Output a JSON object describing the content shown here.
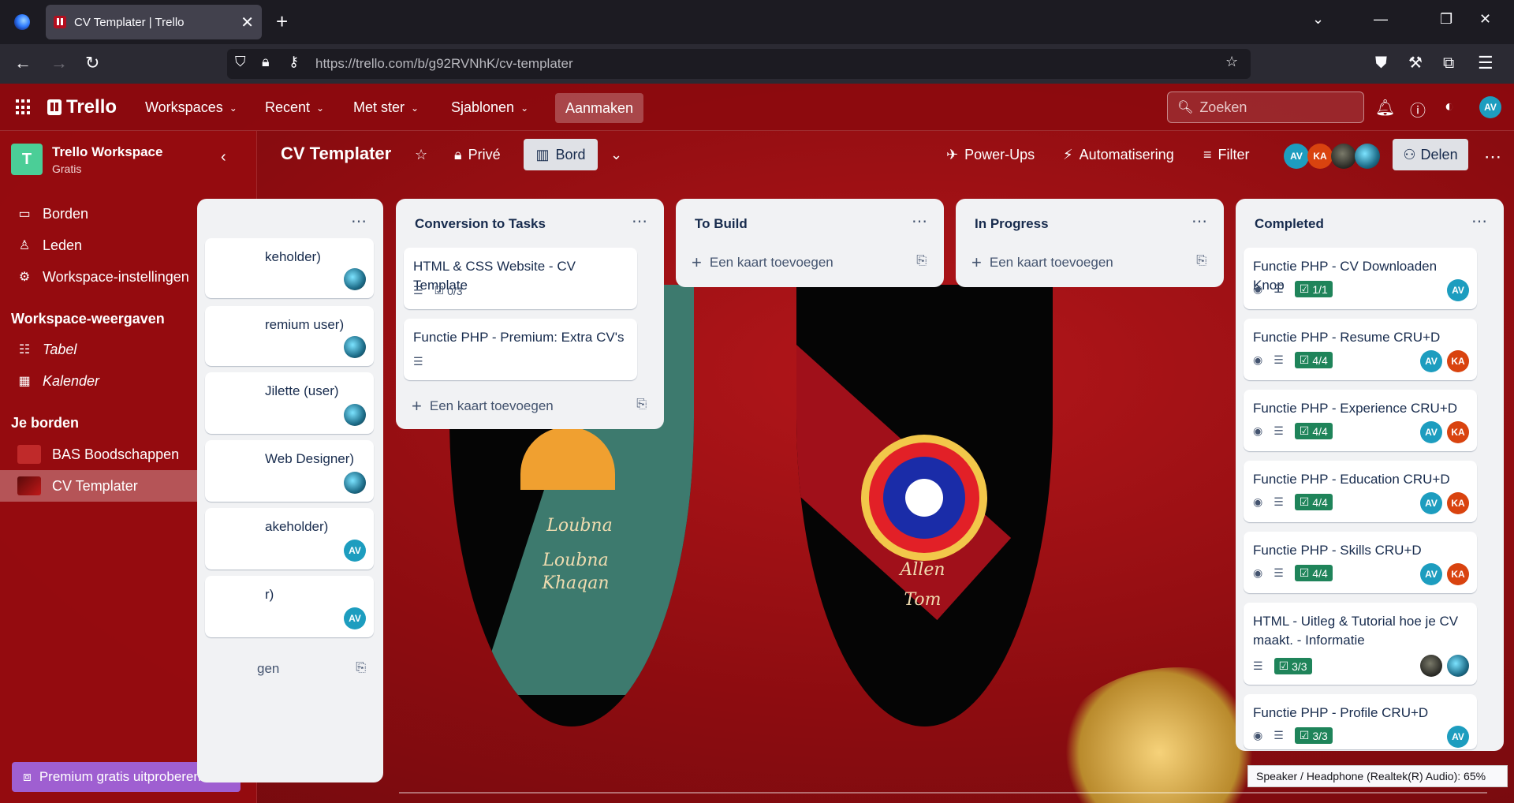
{
  "browser": {
    "tab_title": "CV Templater | Trello",
    "url_host": "https://trello.com",
    "url_path": "/b/g92RVNhK/cv-templater"
  },
  "header": {
    "logo_text": "Trello",
    "menus": [
      "Workspaces",
      "Recent",
      "Met ster",
      "Sjablonen"
    ],
    "create_label": "Aanmaken",
    "search_placeholder": "Zoeken",
    "user_initials": "AV"
  },
  "sidebar": {
    "workspace_initial": "T",
    "workspace_name": "Trello Workspace",
    "workspace_plan": "Gratis",
    "items": [
      {
        "label": "Borden"
      },
      {
        "label": "Leden"
      },
      {
        "label": "Workspace-instellingen"
      }
    ],
    "views_heading": "Workspace-weergaven",
    "views": [
      {
        "label": "Tabel"
      },
      {
        "label": "Kalender"
      }
    ],
    "boards_heading": "Je borden",
    "boards": [
      {
        "label": "BAS Boodschappen"
      },
      {
        "label": "CV Templater"
      }
    ],
    "premium_label": "Premium gratis uitproberen"
  },
  "board": {
    "title": "CV Templater",
    "visibility": "Privé",
    "view_label": "Bord",
    "powerups": "Power-Ups",
    "automation": "Automatisering",
    "filter": "Filter",
    "share": "Delen",
    "members": [
      "AV",
      "KA"
    ]
  },
  "shields": {
    "left_text_1": "Loubna",
    "left_text_2": "Khaqan",
    "right_text_1": "Allen",
    "right_text_2": "Tom"
  },
  "lists": {
    "partial": {
      "cards": [
        {
          "title": "keholder)"
        },
        {
          "title": "remium user)"
        },
        {
          "title": "Jilette (user)"
        },
        {
          "title": "Web Designer)"
        },
        {
          "title": "akeholder)",
          "avatar": "AV"
        },
        {
          "title": "r)",
          "avatar": "AV"
        }
      ],
      "add_label": "gen"
    },
    "conversion": {
      "title": "Conversion to Tasks",
      "cards": [
        {
          "title": "HTML & CSS Website - CV Template",
          "checklist": "0/3"
        },
        {
          "title": "Functie PHP - Premium: Extra CV's"
        }
      ],
      "add_label": "Een kaart toevoegen"
    },
    "to_build": {
      "title": "To Build",
      "add_label": "Een kaart toevoegen"
    },
    "in_progress": {
      "title": "In Progress",
      "add_label": "Een kaart toevoegen"
    },
    "completed": {
      "title": "Completed",
      "cards": [
        {
          "title": "Functie PHP - CV Downloaden Knop",
          "checklist": "1/1",
          "avatars": [
            "AV"
          ]
        },
        {
          "title": "Functie PHP - Resume CRU+D",
          "checklist": "4/4",
          "avatars": [
            "AV",
            "KA"
          ]
        },
        {
          "title": "Functie PHP - Experience CRU+D",
          "checklist": "4/4",
          "avatars": [
            "AV",
            "KA"
          ]
        },
        {
          "title": "Functie PHP - Education CRU+D",
          "checklist": "4/4",
          "avatars": [
            "AV",
            "KA"
          ]
        },
        {
          "title": "Functie PHP - Skills CRU+D",
          "checklist": "4/4",
          "avatars": [
            "AV",
            "KA"
          ]
        },
        {
          "title": "HTML - Uitleg & Tutorial hoe je CV maakt. - Informatie",
          "checklist": "3/3"
        },
        {
          "title": "Functie PHP - Profile CRU+D",
          "checklist": "3/3",
          "avatars": [
            "AV"
          ]
        }
      ]
    }
  },
  "toast": "Speaker / Headphone (Realtek(R) Audio): 65%",
  "colors": {
    "board_bg": "#8d0c10",
    "list_bg": "#f1f2f4",
    "checklist_done": "#1f845a",
    "avatar_av": "#1d9dbf",
    "avatar_ka": "#d9430f",
    "premium": "#9f5fd1"
  }
}
